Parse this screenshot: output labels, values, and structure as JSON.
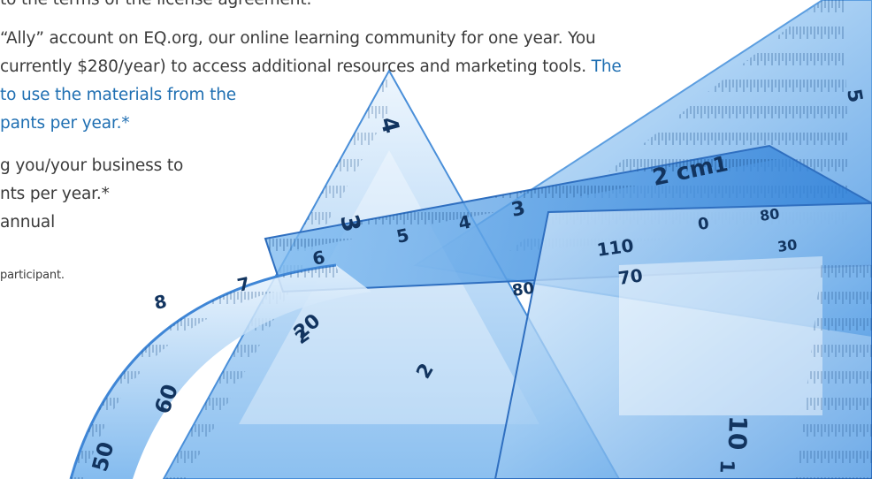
{
  "document": {
    "lines": [
      "to the terms of the license agreement.",
      "“Ally” account on EQ.org, our online learning community for one year. You",
      "currently $280/year) to access additional resources and marketing tools.",
      "to use the materials from the",
      "pants per year.*",
      "g you/your business to",
      "nts per year.*",
      "annual"
    ],
    "line3_highlight": "The",
    "footnote": "participant."
  },
  "colors": {
    "body_text": "#3b3b3b",
    "link_blue": "#1f6fb2"
  },
  "image": {
    "subject": "clear blue plastic rulers, triangles and protractor",
    "ruler_labels": [
      "4",
      "5",
      "3",
      "2 cm",
      "1",
      "3",
      "4",
      "5",
      "6",
      "7",
      "8",
      "110",
      "70",
      "80",
      "0",
      "80",
      "30",
      "20",
      "60",
      "50",
      "10",
      "2",
      "2",
      "1"
    ]
  }
}
